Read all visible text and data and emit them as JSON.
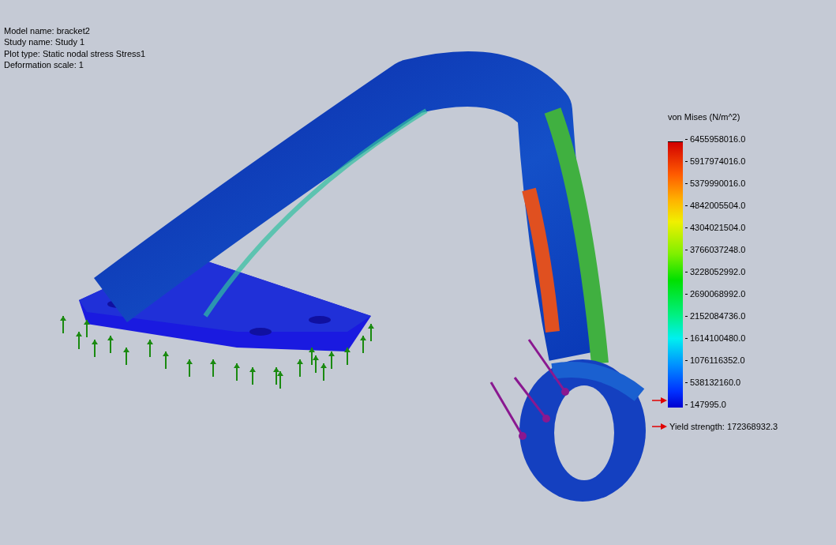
{
  "info": [
    "Model name: bracket2",
    "Study name: Study 1",
    "Plot type: Static nodal stress Stress1",
    "Deformation scale: 1"
  ],
  "legend": {
    "title": "von Mises (N/m^2)",
    "labels": [
      "6455958016.0",
      "5917974016.0",
      "5379990016.0",
      "4842005504.0",
      "4304021504.0",
      "3766037248.0",
      "3228052992.0",
      "2690068992.0",
      "2152084736.0",
      "1614100480.0",
      "1076116352.0",
      "538132160.0",
      "147995.0"
    ]
  },
  "yield_strength": "Yield strength: 172368932.3"
}
